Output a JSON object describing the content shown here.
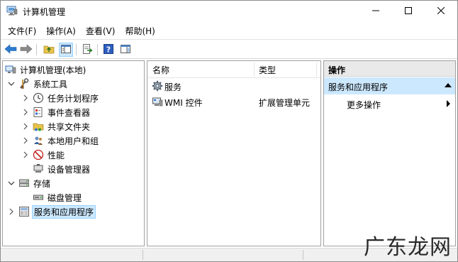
{
  "window": {
    "title": "计算机管理"
  },
  "menu": {
    "items": [
      {
        "label": "文件(F)"
      },
      {
        "label": "操作(A)"
      },
      {
        "label": "查看(V)"
      },
      {
        "label": "帮助(H)"
      }
    ]
  },
  "toolbar": {
    "buttons": [
      "back-icon",
      "forward-icon",
      "up-folder-icon",
      "show-hide-tree-icon",
      "export-list-icon",
      "help-icon",
      "show-hide-action-pane-icon"
    ]
  },
  "tree": {
    "root": "计算机管理(本地)",
    "nodes": [
      {
        "label": "系统工具",
        "icon": "tools-icon",
        "expanded": true
      },
      {
        "label": "任务计划程序",
        "icon": "clock-icon"
      },
      {
        "label": "事件查看器",
        "icon": "event-viewer-icon"
      },
      {
        "label": "共享文件夹",
        "icon": "shared-folder-icon"
      },
      {
        "label": "本地用户和组",
        "icon": "users-icon"
      },
      {
        "label": "性能",
        "icon": "performance-icon"
      },
      {
        "label": "设备管理器",
        "icon": "device-manager-icon"
      },
      {
        "label": "存储",
        "icon": "storage-icon",
        "expanded": true
      },
      {
        "label": "磁盘管理",
        "icon": "disk-icon"
      },
      {
        "label": "服务和应用程序",
        "icon": "services-apps-icon",
        "selected": true
      }
    ]
  },
  "list": {
    "columns": [
      "名称",
      "类型"
    ],
    "rows": [
      {
        "name": "服务",
        "type": "",
        "icon": "gear-icon"
      },
      {
        "name": "WMI 控件",
        "type": "扩展管理单元",
        "icon": "wmi-icon"
      }
    ]
  },
  "actions": {
    "header": "操作",
    "section": "服务和应用程序",
    "items": [
      {
        "label": "更多操作"
      }
    ]
  },
  "watermark": "广东龙网",
  "colors": {
    "selection": "#cce8ff",
    "selection_border": "#99d1ff",
    "action_header": "#e9e9e9"
  }
}
